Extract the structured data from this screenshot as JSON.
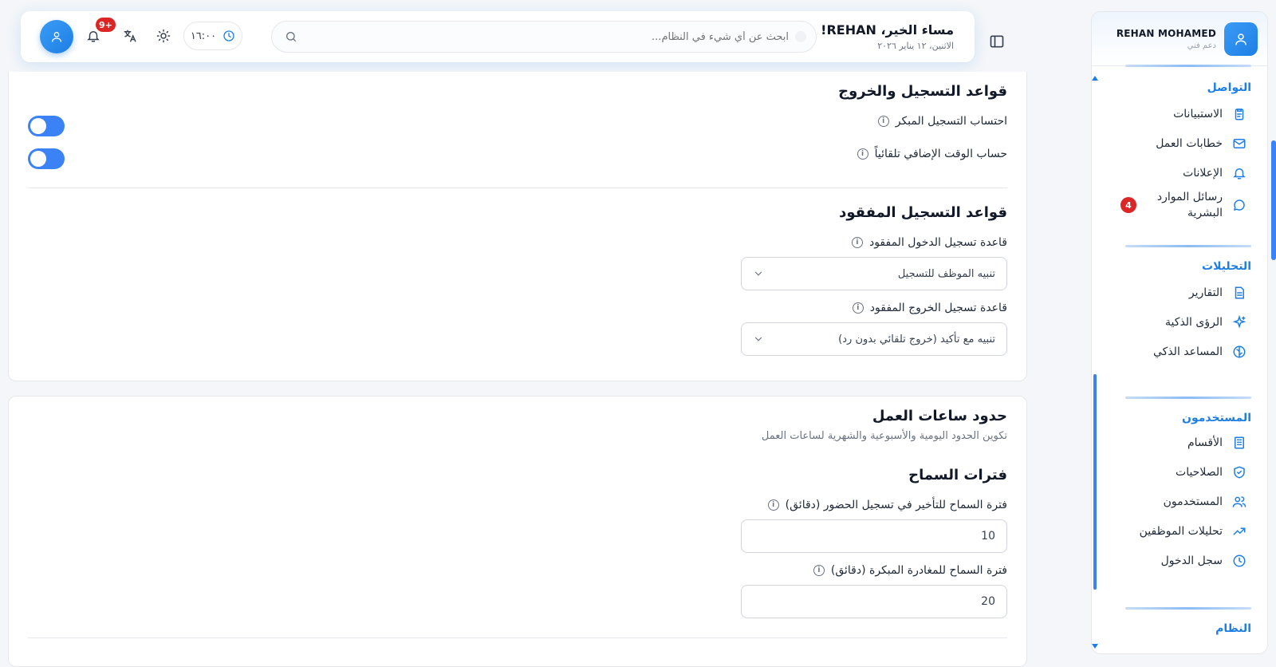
{
  "user": {
    "name": "REHAN MOHAMED",
    "role": "دعم فني"
  },
  "sidebar": {
    "sections": [
      {
        "title": "التواصل",
        "items": [
          {
            "label": "الاستبيانات",
            "icon": "clipboard-icon"
          },
          {
            "label": "خطابات العمل",
            "icon": "mail-icon"
          },
          {
            "label": "الإعلانات",
            "icon": "bell-icon"
          },
          {
            "label": "رسائل الموارد البشرية",
            "icon": "chat-icon",
            "badge": "4"
          }
        ]
      },
      {
        "title": "التحليلات",
        "items": [
          {
            "label": "التقارير",
            "icon": "report-icon"
          },
          {
            "label": "الرؤى الذكية",
            "icon": "sparkle-icon"
          },
          {
            "label": "المساعد الذكي",
            "icon": "brain-icon"
          }
        ]
      },
      {
        "title": "المستخدمون",
        "items": [
          {
            "label": "الأقسام",
            "icon": "building-icon"
          },
          {
            "label": "الصلاحيات",
            "icon": "shield-icon"
          },
          {
            "label": "المستخدمون",
            "icon": "users-icon"
          },
          {
            "label": "تحليلات الموظفين",
            "icon": "trend-icon"
          },
          {
            "label": "سجل الدخول",
            "icon": "clock-icon"
          }
        ]
      },
      {
        "title": "النظام",
        "items": []
      }
    ]
  },
  "header": {
    "greeting": "مساء الخير، REHAN!",
    "date": "الاثنين، ١٢ يناير ٢٠٢٦",
    "search_placeholder": "ابحث عن أي شيء في النظام...",
    "time": "١٦:٠٠",
    "notifications_badge": "+9"
  },
  "card1": {
    "section_checkin": "قواعد التسجيل والخروج",
    "early_checkin_label": "احتساب التسجيل المبكر",
    "overtime_label": "حساب الوقت الإضافي تلقائياً",
    "early_checkin_enabled": true,
    "overtime_enabled": true,
    "section_missed": "قواعد التسجيل المفقود",
    "missed_in_label": "قاعدة تسجيل الدخول المفقود",
    "missed_in_value": "تنبيه الموظف للتسجيل",
    "missed_out_label": "قاعدة تسجيل الخروج المفقود",
    "missed_out_value": "تنبيه مع تأكيد (خروج تلقائي بدون رد)"
  },
  "card2": {
    "title": "حدود ساعات العمل",
    "subtitle": "تكوين الحدود اليومية والأسبوعية والشهرية لساعات العمل",
    "grace_title": "فترات السماح",
    "late_grace_label": "فترة السماح للتأخير في تسجيل الحضور (دقائق)",
    "late_grace_value": "10",
    "early_leave_label": "فترة السماح للمغادرة المبكرة (دقائق)",
    "early_leave_value": "20"
  }
}
